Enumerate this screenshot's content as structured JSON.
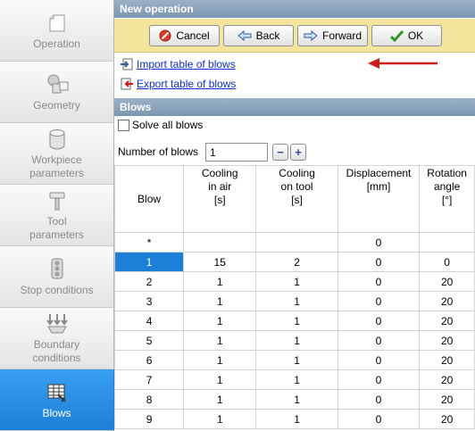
{
  "sidebar": {
    "items": [
      {
        "label": "Operation",
        "icon": "document-icon",
        "active": false
      },
      {
        "label": "Geometry",
        "icon": "shapes-icon",
        "active": false
      },
      {
        "label": "Workpiece\nparameters",
        "icon": "cylinder-icon",
        "active": false
      },
      {
        "label": "Tool\nparameters",
        "icon": "hammer-icon",
        "active": false
      },
      {
        "label": "Stop conditions",
        "icon": "traffic-light-icon",
        "active": false
      },
      {
        "label": "Boundary\nconditions",
        "icon": "boundary-arrows-icon",
        "active": false
      },
      {
        "label": "Blows",
        "icon": "table-icon",
        "active": true
      }
    ]
  },
  "header": {
    "title": "New operation"
  },
  "toolbar": {
    "cancel_label": "Cancel",
    "back_label": "Back",
    "forward_label": "Forward",
    "ok_label": "OK"
  },
  "links": {
    "import_label": "Import table of blows",
    "export_label": "Export table of blows"
  },
  "blows_section": {
    "title": "Blows",
    "solve_all_label": "Solve all blows",
    "solve_all_checked": false,
    "number_of_blows_label": "Number of blows",
    "number_of_blows_value": "1",
    "minus_label": "−",
    "plus_label": "+"
  },
  "table": {
    "columns": [
      "Blow",
      "Cooling\nin air\n[s]",
      "Cooling\non tool\n[s]",
      "Displacement\n[mm]",
      "Rotation\nangle\n[°]"
    ],
    "new_row": {
      "blow": "*",
      "cooling_air": "",
      "cooling_tool": "",
      "displacement": "0",
      "rotation": ""
    },
    "rows": [
      {
        "blow": "1",
        "cooling_air": "15",
        "cooling_tool": "2",
        "displacement": "0",
        "rotation": "0"
      },
      {
        "blow": "2",
        "cooling_air": "1",
        "cooling_tool": "1",
        "displacement": "0",
        "rotation": "20"
      },
      {
        "blow": "3",
        "cooling_air": "1",
        "cooling_tool": "1",
        "displacement": "0",
        "rotation": "20"
      },
      {
        "blow": "4",
        "cooling_air": "1",
        "cooling_tool": "1",
        "displacement": "0",
        "rotation": "20"
      },
      {
        "blow": "5",
        "cooling_air": "1",
        "cooling_tool": "1",
        "displacement": "0",
        "rotation": "20"
      },
      {
        "blow": "6",
        "cooling_air": "1",
        "cooling_tool": "1",
        "displacement": "0",
        "rotation": "20"
      },
      {
        "blow": "7",
        "cooling_air": "1",
        "cooling_tool": "1",
        "displacement": "0",
        "rotation": "20"
      },
      {
        "blow": "8",
        "cooling_air": "1",
        "cooling_tool": "1",
        "displacement": "0",
        "rotation": "20"
      },
      {
        "blow": "9",
        "cooling_air": "1",
        "cooling_tool": "1",
        "displacement": "0",
        "rotation": "20"
      }
    ]
  },
  "colors": {
    "active_nav": "#1c7fd8",
    "toolbar_bg": "#f3e59c",
    "section_header": "#8aa3bb",
    "link": "#0d2fd8",
    "annotation_arrow": "#d11a1a"
  }
}
